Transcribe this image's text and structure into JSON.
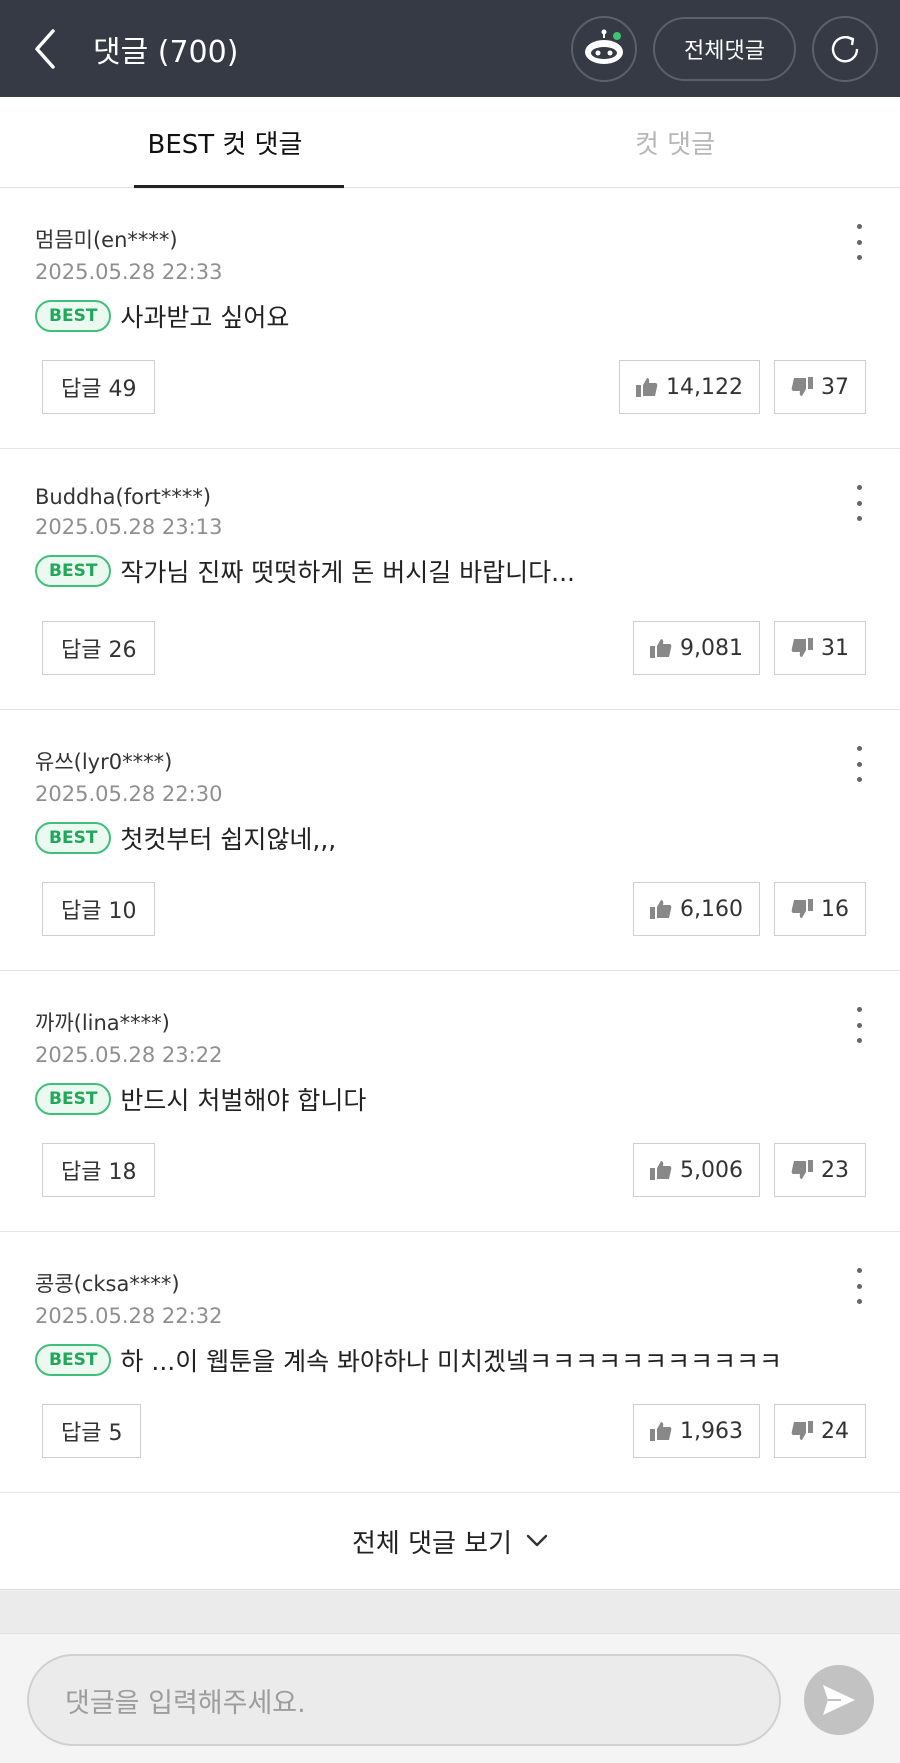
{
  "header": {
    "title": "댓글 (700)",
    "all_comments_button": "전체댓글",
    "icons": [
      "back-arrow-icon",
      "clean-bot-icon",
      "refresh-icon"
    ]
  },
  "tabs": [
    {
      "label": "BEST 컷 댓글",
      "active": true
    },
    {
      "label": "컷 댓글",
      "active": false
    }
  ],
  "comments": [
    {
      "author": "멈믐미(en****)",
      "date": "2025.05.28 22:33",
      "badge": "BEST",
      "text": "사과받고 싶어요",
      "reply_label": "답글 49",
      "likes": "14,122",
      "dislikes": "37"
    },
    {
      "author": "Buddha(fort****)",
      "date": "2025.05.28 23:13",
      "badge": "BEST",
      "text": "작가님 진짜 떳떳하게 돈 버시길 바랍니다...",
      "reply_label": "답글 26",
      "likes": "9,081",
      "dislikes": "31"
    },
    {
      "author": "유쓰(lyr0****)",
      "date": "2025.05.28 22:30",
      "badge": "BEST",
      "text": "첫컷부터 쉽지않네,,,",
      "reply_label": "답글 10",
      "likes": "6,160",
      "dislikes": "16"
    },
    {
      "author": "까까(lina****)",
      "date": "2025.05.28 23:22",
      "badge": "BEST",
      "text": "반드시 처벌해야 합니다",
      "reply_label": "답글 18",
      "likes": "5,006",
      "dislikes": "23"
    },
    {
      "author": "콩콩(cksa****)",
      "date": "2025.05.28 22:32",
      "badge": "BEST",
      "text": "하 ...이 웹툰을 계속 봐야하나 미치겠넼ㅋㅋㅋㅋㅋㅋㅋㅋㅋㅋㅋ",
      "reply_label": "답글 5",
      "likes": "1,963",
      "dislikes": "24"
    }
  ],
  "view_all": {
    "label": "전체 댓글 보기"
  },
  "composer": {
    "placeholder": "댓글을 입력해주세요."
  },
  "colors": {
    "header_bg": "#353a45",
    "best_green": "#20a85a",
    "send_gray": "#c2c2c2"
  }
}
